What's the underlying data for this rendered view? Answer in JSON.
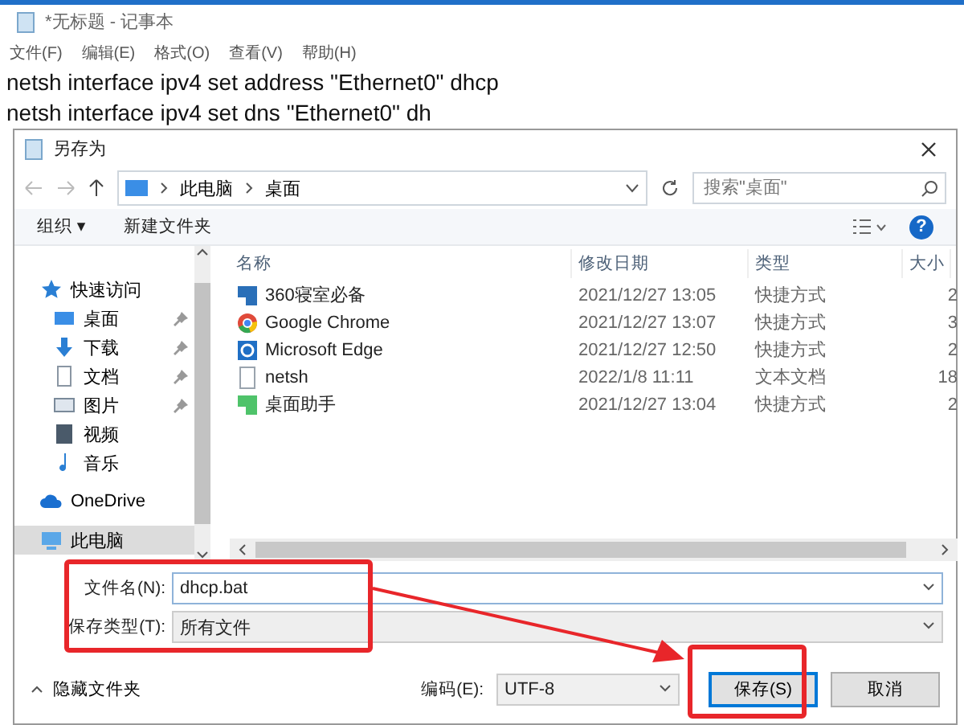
{
  "notepad": {
    "title": "*无标题 - 记事本",
    "menu": [
      "文件(F)",
      "编辑(E)",
      "格式(O)",
      "查看(V)",
      "帮助(H)"
    ],
    "lines": [
      "netsh interface ipv4 set address \"Ethernet0\" dhcp",
      "netsh interface ipv4 set dns \"Ethernet0\" dh"
    ]
  },
  "dialog": {
    "title": "另存为",
    "path": [
      "此电脑",
      "桌面"
    ],
    "search": {
      "placeholder": "搜索\"桌面\""
    },
    "toolbar": [
      "组织 ▾",
      "新建文件夹"
    ],
    "help": "?",
    "nav": [
      {
        "label": "快速访问",
        "kind": "star",
        "pinned": false,
        "selected": false,
        "children": [
          {
            "label": "桌面",
            "kind": "desktop",
            "pinned": true,
            "selected": false
          },
          {
            "label": "下载",
            "kind": "download",
            "pinned": true,
            "selected": false
          },
          {
            "label": "文档",
            "kind": "doc",
            "pinned": true,
            "selected": false
          },
          {
            "label": "图片",
            "kind": "picture",
            "pinned": true,
            "selected": false
          },
          {
            "label": "视频",
            "kind": "video",
            "pinned": false,
            "selected": false
          },
          {
            "label": "音乐",
            "kind": "music",
            "pinned": false,
            "selected": false
          }
        ]
      },
      {
        "label": "OneDrive",
        "kind": "cloud",
        "pinned": false,
        "selected": false
      },
      {
        "label": "此电脑",
        "kind": "pc",
        "pinned": false,
        "selected": true
      }
    ],
    "columns": [
      "名称",
      "修改日期",
      "类型",
      "大小"
    ],
    "files": [
      {
        "name": "360寝室必备",
        "date": "2021/12/27 13:05",
        "type": "快捷方式",
        "size": "2",
        "kind": "shortcut-blue"
      },
      {
        "name": "Google Chrome",
        "date": "2021/12/27 13:07",
        "type": "快捷方式",
        "size": "3",
        "kind": "chrome"
      },
      {
        "name": "Microsoft Edge",
        "date": "2021/12/27 12:50",
        "type": "快捷方式",
        "size": "2",
        "kind": "edge"
      },
      {
        "name": "netsh",
        "date": "2022/1/8 11:11",
        "type": "文本文档",
        "size": "18",
        "kind": "text"
      },
      {
        "name": "桌面助手",
        "date": "2021/12/27 13:04",
        "type": "快捷方式",
        "size": "2",
        "kind": "shortcut-green"
      }
    ],
    "filename": {
      "label": "文件名(N):",
      "value": "dhcp.bat"
    },
    "filetype": {
      "label": "保存类型(T):",
      "value": "所有文件"
    },
    "hide_folders": "隐藏文件夹",
    "encoding": {
      "label": "编码(E):",
      "value": "UTF-8"
    },
    "buttons": [
      "保存(S)",
      "取消"
    ]
  }
}
